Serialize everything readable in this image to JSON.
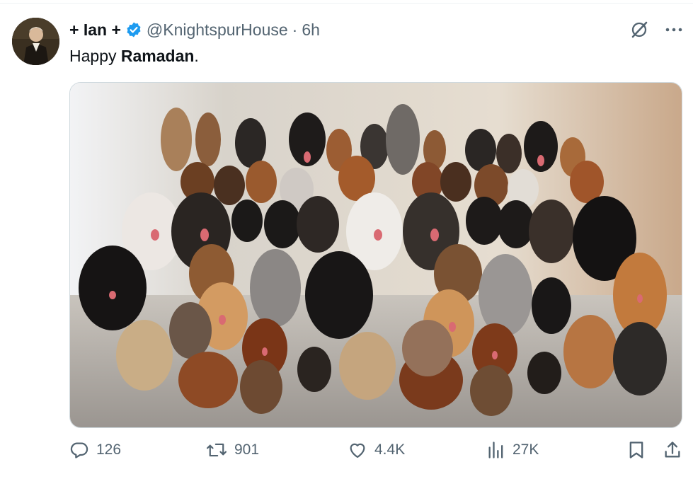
{
  "tweet": {
    "display_name": "+ Ian +",
    "handle": "@KnightspurHouse",
    "separator": "·",
    "time": "6h",
    "text_prefix": "Happy ",
    "text_bold": "Ramadan",
    "text_suffix": ".",
    "media_alt": "Group photo of many dogs of different breeds sitting together"
  },
  "icons": {
    "verified": "verified-badge-icon",
    "grok": "grok-icon",
    "more": "more-icon",
    "reply": "reply-icon",
    "retweet": "retweet-icon",
    "like": "like-icon",
    "views": "views-icon",
    "bookmark": "bookmark-icon",
    "share": "share-icon"
  },
  "stats": {
    "replies": "126",
    "retweets": "901",
    "likes": "4.4K",
    "views": "27K"
  },
  "colors": {
    "verified": "#1d9bf0",
    "muted": "#536471",
    "text": "#0f1419"
  }
}
